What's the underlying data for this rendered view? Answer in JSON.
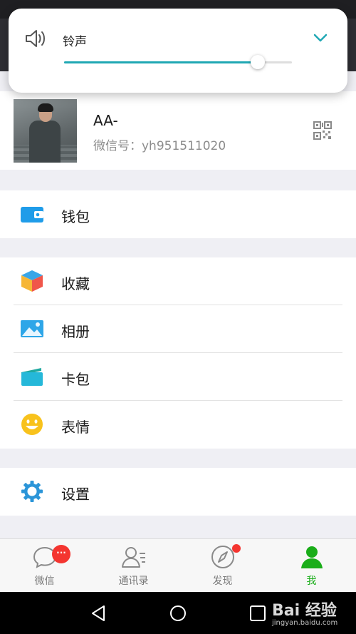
{
  "volume": {
    "title": "铃声",
    "level": 0.85,
    "icons": {
      "speaker": "speaker-icon",
      "collapse": "chevron-down-icon"
    }
  },
  "profile": {
    "name": "AA-",
    "wechat_id": "微信号：yh951511020",
    "icons": {
      "qr": "qr-code-icon"
    }
  },
  "menu": {
    "wallet": {
      "label": "钱包",
      "icon": "wallet-icon"
    },
    "favorites": {
      "label": "收藏",
      "icon": "favorites-cube-icon"
    },
    "album": {
      "label": "相册",
      "icon": "album-image-icon"
    },
    "cards": {
      "label": "卡包",
      "icon": "card-wallet-icon"
    },
    "stickers": {
      "label": "表情",
      "icon": "smiley-face-icon"
    },
    "settings": {
      "label": "设置",
      "icon": "gear-icon"
    }
  },
  "tabs": [
    {
      "label": "微信",
      "icon": "chat-bubble-icon",
      "badge": "···"
    },
    {
      "label": "通讯录",
      "icon": "contacts-icon"
    },
    {
      "label": "发现",
      "icon": "compass-icon"
    },
    {
      "label": "我",
      "icon": "person-icon"
    }
  ],
  "watermark": {
    "brand": "Bai  经验",
    "url": "jingyan.baidu.com"
  },
  "colors": {
    "accent_teal": "#20a8b4",
    "active_green": "#1aad19",
    "badge_red": "#f43530",
    "wallet_blue": "#1f9ce9"
  }
}
